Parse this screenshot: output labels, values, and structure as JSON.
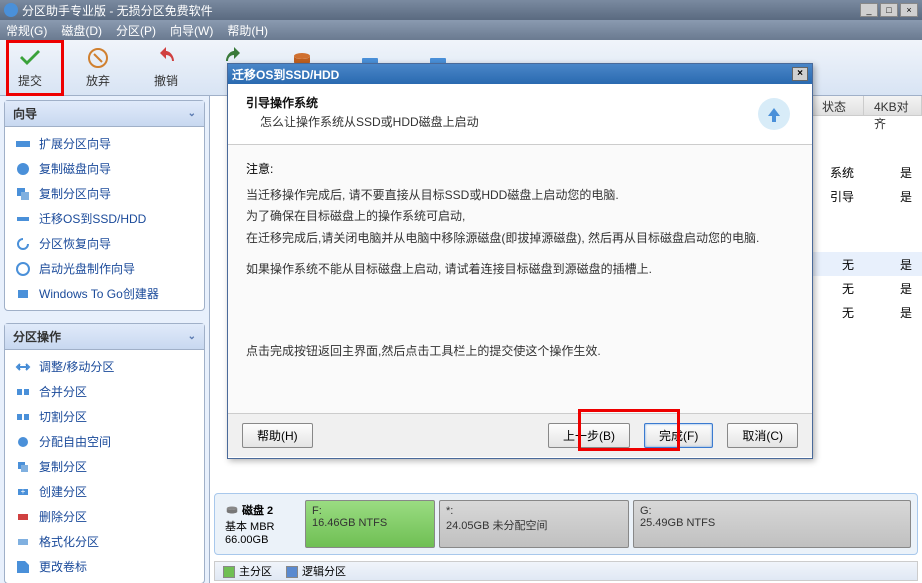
{
  "window": {
    "title": "分区助手专业版 - 无损分区免费软件"
  },
  "menu": [
    "常规(G)",
    "磁盘(D)",
    "分区(P)",
    "向导(W)",
    "帮助(H)"
  ],
  "toolbar": {
    "submit": "提交",
    "discard": "放弃",
    "undo": "撤销",
    "redo": "重"
  },
  "sidebar": {
    "panel1": {
      "title": "向导",
      "items": [
        "扩展分区向导",
        "复制磁盘向导",
        "复制分区向导",
        "迁移OS到SSD/HDD",
        "分区恢复向导",
        "启动光盘制作向导",
        "Windows To Go创建器"
      ]
    },
    "panel2": {
      "title": "分区操作",
      "items": [
        "调整/移动分区",
        "合并分区",
        "切割分区",
        "分配自由空间",
        "复制分区",
        "创建分区",
        "删除分区",
        "格式化分区",
        "更改卷标"
      ]
    }
  },
  "table": {
    "headers": [
      "状态",
      "4KB对齐"
    ],
    "rows": [
      [
        "系统",
        "是"
      ],
      [
        "引导",
        "是"
      ],
      [
        "无",
        "是"
      ],
      [
        "无",
        "是"
      ],
      [
        "无",
        "是"
      ]
    ]
  },
  "disk2": {
    "label": "磁盘 2",
    "type": "基本 MBR",
    "size": "66.00GB",
    "parts": [
      {
        "letter": "F:",
        "size": "16.46GB NTFS",
        "cls": "green"
      },
      {
        "letter": "*:",
        "size": "24.05GB 未分配空间",
        "cls": "gray"
      },
      {
        "letter": "G:",
        "size": "25.49GB NTFS",
        "cls": "gray"
      }
    ]
  },
  "legend": {
    "primary": "主分区",
    "logical": "逻辑分区"
  },
  "dialog": {
    "title": "迁移OS到SSD/HDD",
    "header": "引导操作系统",
    "subheader": "怎么让操作系统从SSD或HDD磁盘上启动",
    "note_title": "注意:",
    "line1": "当迁移操作完成后, 请不要直接从目标SSD或HDD磁盘上启动您的电脑.",
    "line2": "为了确保在目标磁盘上的操作系统可启动,",
    "line3": "在迁移完成后,请关闭电脑并从电脑中移除源磁盘(即拔掉源磁盘), 然后再从目标磁盘启动您的电脑.",
    "line4": "如果操作系统不能从目标磁盘上启动, 请试着连接目标磁盘到源磁盘的插槽上.",
    "tip": "点击完成按钮返回主界面,然后点击工具栏上的提交使这个操作生效.",
    "btn_help": "帮助(H)",
    "btn_prev": "上一步(B)",
    "btn_finish": "完成(F)",
    "btn_cancel": "取消(C)"
  }
}
